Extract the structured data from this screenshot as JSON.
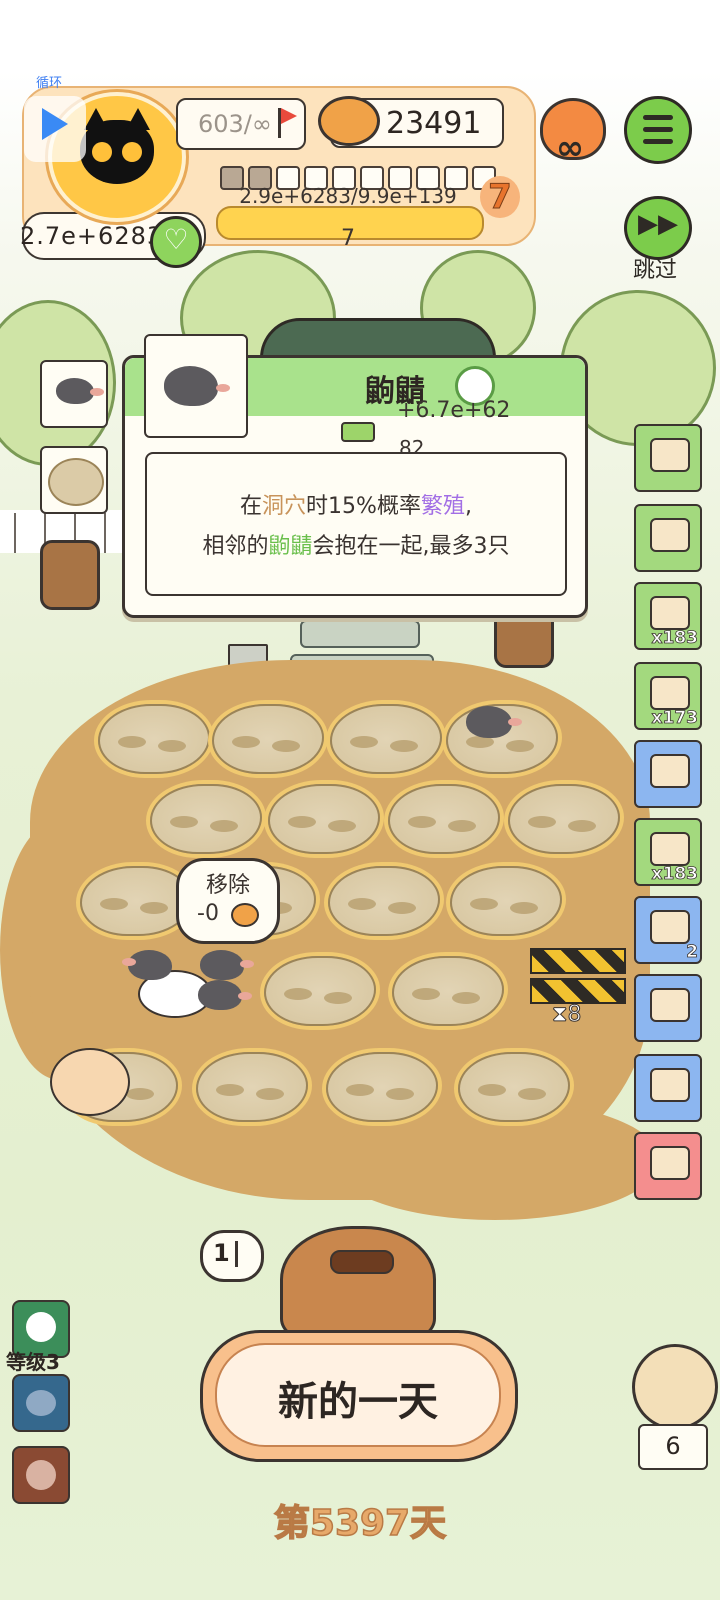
{
  "hud": {
    "loop_label": "循环",
    "flags": "603/∞",
    "coins": "23491",
    "currency": "2.7e+6283",
    "progress_text": "2.9e+6283/9.9e+139",
    "level": "7",
    "exp_value": "7",
    "slots_filled": 2,
    "slots_total": 10,
    "skip_label": "跳过",
    "infinity": "∞"
  },
  "popup": {
    "title": "鼩鼱",
    "value": "+6.7e+62",
    "value2": "82",
    "desc_line1_a": "在",
    "desc_line1_b": "洞穴",
    "desc_line1_c": "时15%概率",
    "desc_line1_d": "繁殖",
    "desc_line1_e": ",",
    "desc_line2_a": "相邻的",
    "desc_line2_b": "鼩鼱",
    "desc_line2_c": "会抱在一起,最多3只"
  },
  "side_items": [
    {
      "name": "card",
      "count": ""
    },
    {
      "name": "ticket",
      "count": ""
    },
    {
      "name": "coin-ticket",
      "count": "x183"
    },
    {
      "name": "worms",
      "count": "x173"
    },
    {
      "name": "hut",
      "count": ""
    },
    {
      "name": "tent",
      "count": "x183"
    },
    {
      "name": "shovel",
      "count": "2"
    },
    {
      "name": "can",
      "count": ""
    },
    {
      "name": "trap",
      "count": ""
    },
    {
      "name": "photo",
      "count": ""
    }
  ],
  "field": {
    "remove_label": "移除",
    "remove_cost": "-0",
    "barrier_timer": "8",
    "flag_count": "1"
  },
  "bottom": {
    "level_label": "等级3",
    "new_day": "新的一天",
    "day_counter": "第5397天",
    "pet_count": "6"
  },
  "colors": {
    "accent_green": "#7ccc4b",
    "gold": "#ffd34f",
    "dirt": "#d4a867"
  }
}
